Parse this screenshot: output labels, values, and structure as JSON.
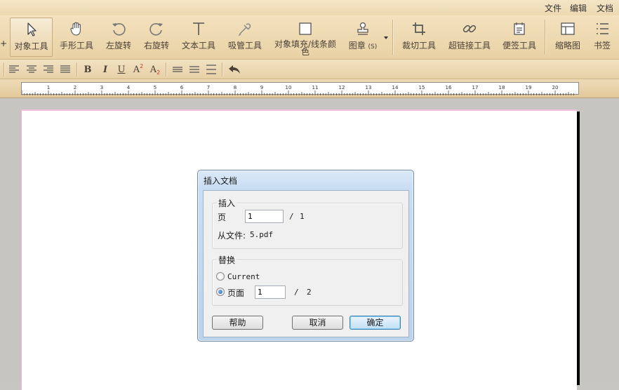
{
  "menubar": {
    "items": [
      "文件",
      "编辑",
      "文档"
    ]
  },
  "toolbar": {
    "pin": "+",
    "tools": {
      "object": "对象工具",
      "hand": "手形工具",
      "rotate_left": "左旋转",
      "rotate_right": "右旋转",
      "text": "文本工具",
      "eyedropper": "吸管工具",
      "fill_line1": "对象填充/线条颜",
      "fill_line2": "色",
      "stamp": "图章",
      "stamp_shortcut": "(S)",
      "crop": "裁切工具",
      "link": "超链接工具",
      "note": "便签工具",
      "thumbnail": "缩略图",
      "bookmark": "书签"
    }
  },
  "formatbar": {
    "bold": "B",
    "italic": "I",
    "underline": "U",
    "superscript_base": "A",
    "superscript_mark": "2",
    "subscript_base": "A",
    "subscript_mark": "2"
  },
  "ruler": {
    "numbers": [
      "1",
      "2",
      "3",
      "4",
      "5",
      "6",
      "7",
      "8",
      "9",
      "10",
      "11",
      "12",
      "13",
      "14",
      "15",
      "16",
      "17",
      "18",
      "19",
      "20"
    ]
  },
  "dialog": {
    "title": "插入文档",
    "insert_group": {
      "label": "插入",
      "page_label": "页",
      "page_value": "1",
      "separator": "/",
      "page_total": "1",
      "from_file_label": "从文件:",
      "file_name": "5.pdf"
    },
    "replace_group": {
      "label": "替换",
      "option_current": "Current",
      "option_page": "页面",
      "page_value": "1",
      "separator": "/",
      "page_total": "2",
      "selected": "page"
    },
    "buttons": {
      "help": "帮助",
      "cancel": "取消",
      "ok": "确定"
    }
  }
}
